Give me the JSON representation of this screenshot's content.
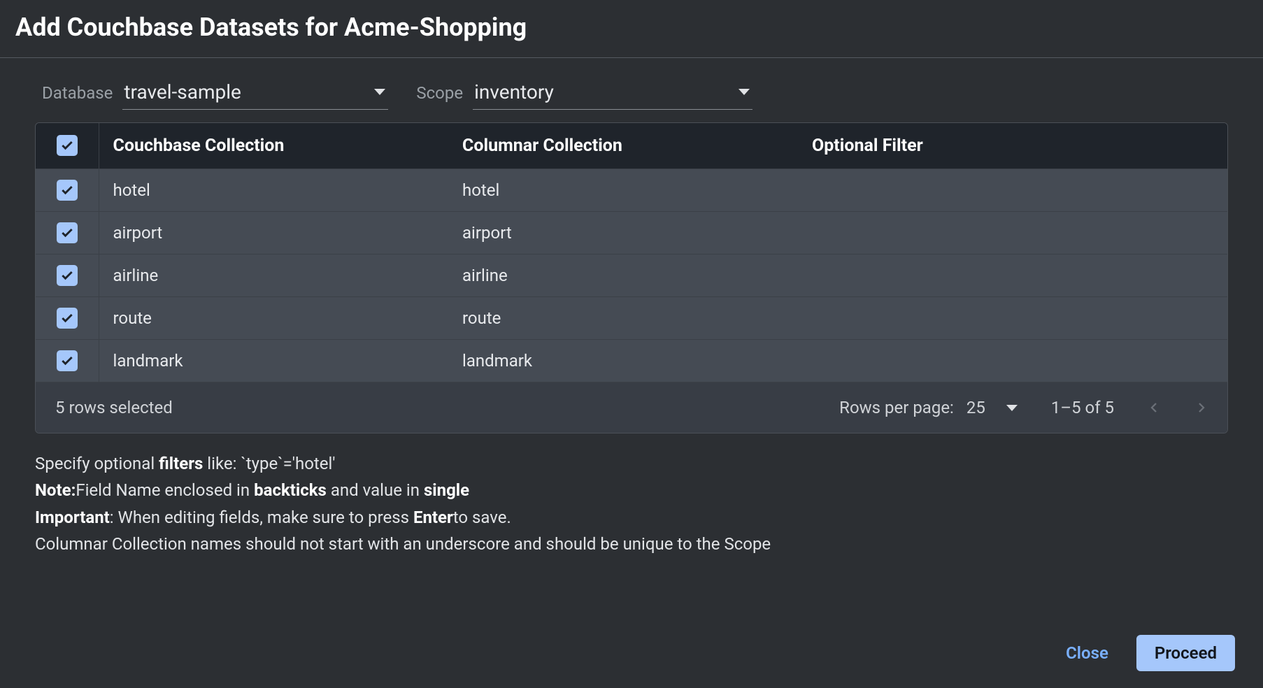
{
  "title": "Add Couchbase Datasets for Acme-Shopping",
  "selectors": {
    "database_label": "Database",
    "database_value": "travel-sample",
    "scope_label": "Scope",
    "scope_value": "inventory"
  },
  "table": {
    "headers": {
      "couchbase": "Couchbase Collection",
      "columnar": "Columnar Collection",
      "filter": "Optional Filter"
    },
    "rows": [
      {
        "checked": true,
        "couchbase": "hotel",
        "columnar": "hotel",
        "filter": ""
      },
      {
        "checked": true,
        "couchbase": "airport",
        "columnar": "airport",
        "filter": ""
      },
      {
        "checked": true,
        "couchbase": "airline",
        "columnar": "airline",
        "filter": ""
      },
      {
        "checked": true,
        "couchbase": "route",
        "columnar": "route",
        "filter": ""
      },
      {
        "checked": true,
        "couchbase": "landmark",
        "columnar": "landmark",
        "filter": ""
      }
    ]
  },
  "footer": {
    "selected_text": "5 rows selected",
    "rpp_label": "Rows per page:",
    "rpp_value": "25",
    "range_text": "1–5 of 5"
  },
  "help": {
    "l1_a": "Specify optional ",
    "l1_b": "filters",
    "l1_c": " like: `type`='hotel'",
    "l2_a": "Note:",
    "l2_b": "Field Name enclosed in ",
    "l2_c": "backticks",
    "l2_d": " and value in ",
    "l2_e": "single",
    "l3_a": "Important",
    "l3_b": ": When editing fields, make sure to press ",
    "l3_c": "Enter",
    "l3_d": "to save.",
    "l4": "Columnar Collection names should not start with an underscore and should be unique to the Scope"
  },
  "actions": {
    "close": "Close",
    "proceed": "Proceed"
  }
}
